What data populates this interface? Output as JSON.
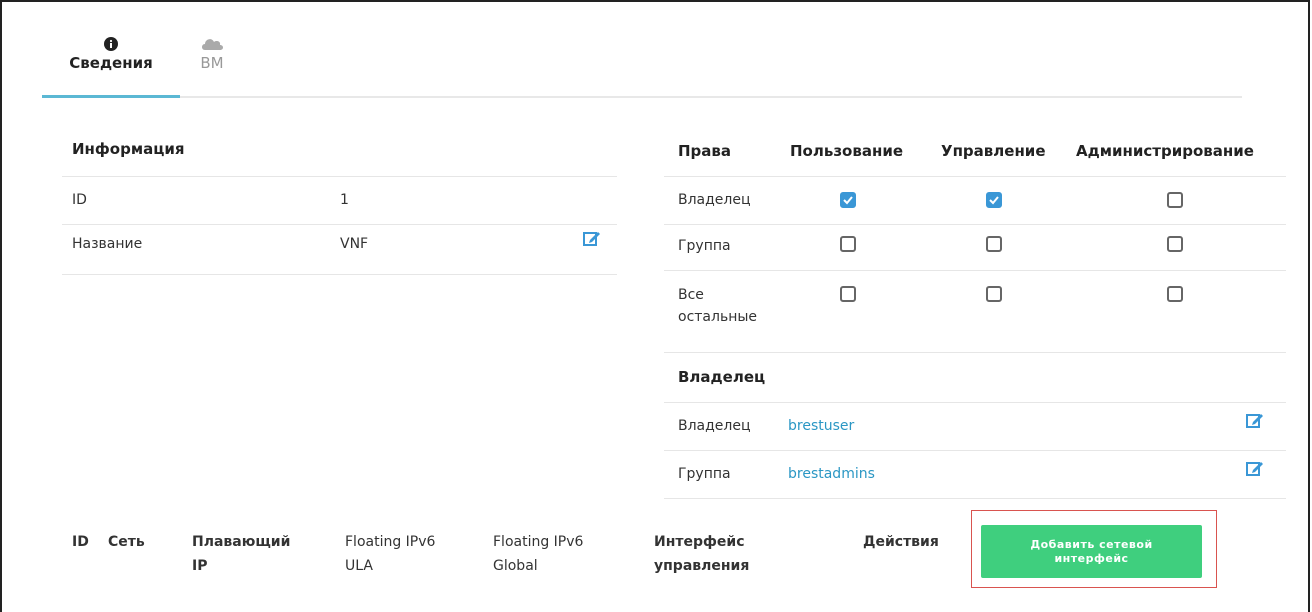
{
  "tabs": [
    {
      "label": "Сведения",
      "icon": "info-circle-icon",
      "active": true
    },
    {
      "label": "ВМ",
      "icon": "cloud-icon",
      "active": false
    }
  ],
  "info": {
    "header": "Информация",
    "rows": [
      {
        "label": "ID",
        "value": "1"
      },
      {
        "label": "Название",
        "value": "VNF",
        "editable": true
      }
    ]
  },
  "permissions": {
    "headers": [
      "Права",
      "Пользование",
      "Управление",
      "Администрирование"
    ],
    "rows": [
      {
        "label": "Владелец",
        "use": true,
        "manage": true,
        "admin": false
      },
      {
        "label": "Группа",
        "use": false,
        "manage": false,
        "admin": false
      },
      {
        "label": "Все остальные",
        "use": false,
        "manage": false,
        "admin": false
      }
    ]
  },
  "ownership": {
    "header": "Владелец",
    "rows": [
      {
        "label": "Владелец",
        "value": "brestuser"
      },
      {
        "label": "Группа",
        "value": "brestadmins"
      }
    ]
  },
  "nic_table": {
    "headers": [
      "ID",
      "Сеть",
      "Плавающий IP",
      "Floating IPv6 ULA",
      "Floating IPv6 Global",
      "Интерфейс управления",
      "Действия"
    ]
  },
  "add_nic_button": "Добавить сетевой интерфейс",
  "colors": {
    "accent": "#5bb8d4",
    "link": "#2b97c4",
    "button": "#3fcf7e",
    "checkbox": "#3a97d6",
    "highlight": "#d9534f"
  }
}
